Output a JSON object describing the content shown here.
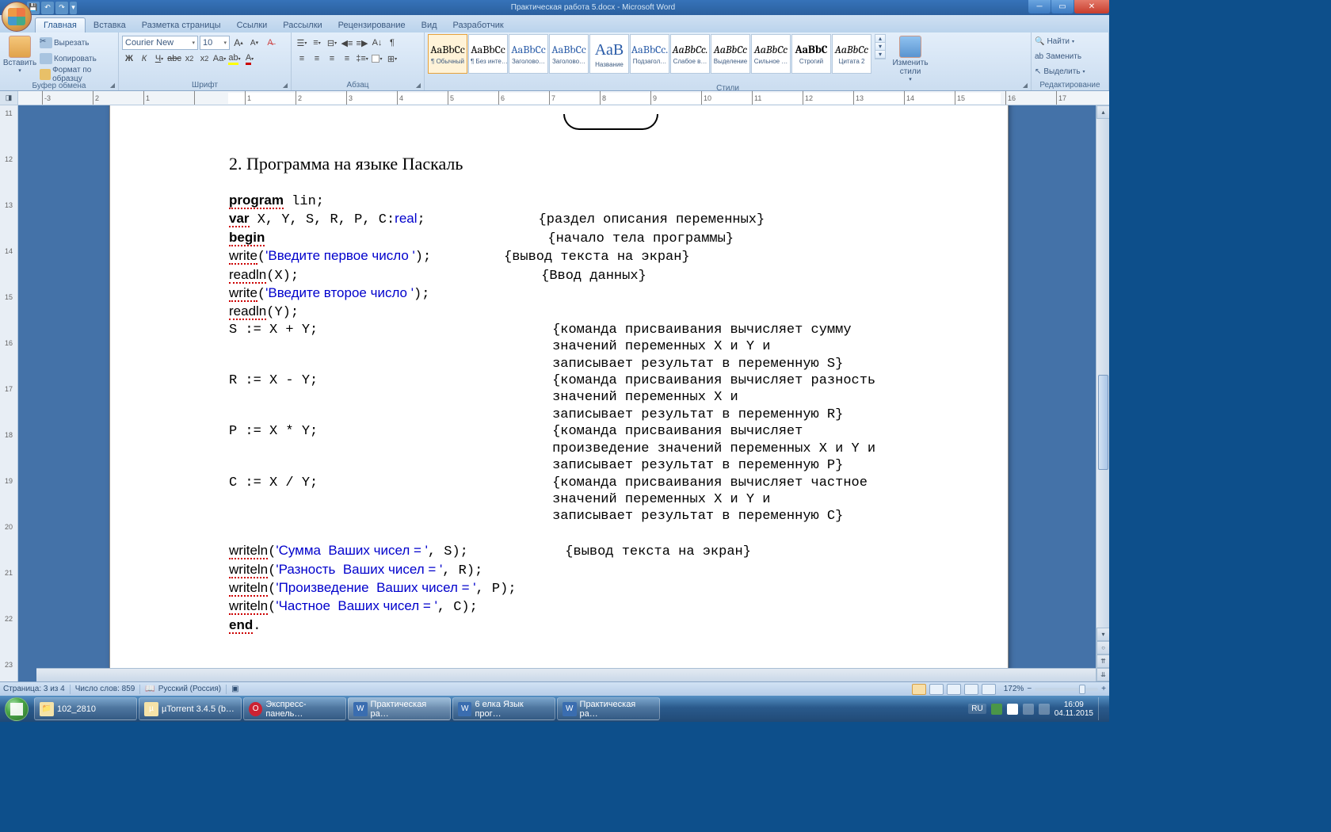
{
  "title_bar": {
    "document_title": "Практическая работа 5.docx - Microsoft Word"
  },
  "tabs": [
    "Главная",
    "Вставка",
    "Разметка страницы",
    "Ссылки",
    "Рассылки",
    "Рецензирование",
    "Вид",
    "Разработчик"
  ],
  "ribbon": {
    "clipboard": {
      "title": "Буфер обмена",
      "paste": "Вставить",
      "cut": "Вырезать",
      "copy": "Копировать",
      "painter": "Формат по образцу"
    },
    "font": {
      "title": "Шрифт",
      "family": "Courier New",
      "size": "10"
    },
    "paragraph": {
      "title": "Абзац"
    },
    "styles": {
      "title": "Стили",
      "items": [
        {
          "preview": "AaBbCc",
          "label": "¶ Обычный",
          "sel": true
        },
        {
          "preview": "AaBbCc",
          "label": "¶ Без инте…"
        },
        {
          "preview": "AaBbCc",
          "label": "Заголово…",
          "blue": true
        },
        {
          "preview": "AaBbCc",
          "label": "Заголово…",
          "blue": true
        },
        {
          "preview": "АаВ",
          "label": "Название",
          "blue": true,
          "big": true
        },
        {
          "preview": "AaBbCc.",
          "label": "Подзагол…",
          "blue": true
        },
        {
          "preview": "AaBbCc.",
          "label": "Слабое в…",
          "it": true
        },
        {
          "preview": "AaBbCc",
          "label": "Выделение",
          "it": true
        },
        {
          "preview": "AaBbCc",
          "label": "Сильное …",
          "it": true
        },
        {
          "preview": "AaBbC",
          "label": "Строгий",
          "bold": true
        },
        {
          "preview": "AaBbCc",
          "label": "Цитата 2",
          "it": true
        }
      ],
      "change": "Изменить стили"
    },
    "editing": {
      "title": "Редактирование",
      "find": "Найти",
      "replace": "Заменить",
      "select": "Выделить"
    }
  },
  "ruler_h": [
    "-3",
    "2",
    "1",
    "",
    "1",
    "2",
    "3",
    "4",
    "5",
    "6",
    "7",
    "8",
    "9",
    "10",
    "11",
    "12",
    "13",
    "14",
    "15",
    "16",
    "17"
  ],
  "ruler_v": [
    "11",
    "12",
    "13",
    "14",
    "15",
    "16",
    "17",
    "18",
    "19",
    "20",
    "21",
    "22",
    "23"
  ],
  "document": {
    "heading": "2. Программа на языке Паскаль",
    "code_lines": [
      {
        "t": "program lin;",
        "c": "",
        "pk": true
      },
      {
        "t": "var X, Y, S, R, P, C:real;",
        "c": "{раздел описания переменных}",
        "kw": "var",
        "ty": "real"
      },
      {
        "t": "begin",
        "c": "{начало тела программы}",
        "pk": true
      },
      {
        "t": "write('Введите первое число ');",
        "c": "{вывод текста на экран}",
        "fn": "write",
        "s": "'Введите первое число '"
      },
      {
        "t": "readln(X);",
        "c": "{Ввод данных}",
        "fn": "readln"
      },
      {
        "t": "write('Введите второе число ');",
        "c": "",
        "fn": "write",
        "s": "'Введите второе число '"
      },
      {
        "t": "readln(Y);",
        "c": "",
        "fn": "readln"
      },
      {
        "t": "S := X + Y;",
        "c": "{команда присваивания вычисляет сумму"
      },
      {
        "t": "",
        "c": "значений переменных X и Y и"
      },
      {
        "t": "",
        "c": "записывает результат в переменную S}"
      },
      {
        "t": "R := X - Y;",
        "c": "{команда присваивания вычисляет разность"
      },
      {
        "t": "",
        "c": "значений переменных X и"
      },
      {
        "t": "",
        "c": "записывает результат в переменную R}"
      },
      {
        "t": "P := X * Y;",
        "c": "{команда присваивания вычисляет"
      },
      {
        "t": "",
        "c": "произведение значений переменных X и Y и"
      },
      {
        "t": "",
        "c": "записывает результат в переменную P}"
      },
      {
        "t": "C := X / Y;",
        "c": "{команда присваивания вычисляет частное"
      },
      {
        "t": "",
        "c": "значений переменных X и Y и"
      },
      {
        "t": "",
        "c": "записывает результат в переменную C}"
      },
      {
        "t": "",
        "c": ""
      },
      {
        "t": "writeln('Сумма  Ваших чисел = ', S);",
        "c": "        {вывод текста на экран}",
        "fn": "writeln",
        "s": "'Сумма  Ваших чисел = '"
      },
      {
        "t": "writeln('Разность  Ваших чисел = ', R);",
        "c": "",
        "fn": "writeln",
        "s": "'Разность  Ваших чисел = '"
      },
      {
        "t": "writeln('Произведение  Ваших чисел = ', P);",
        "c": "",
        "fn": "writeln",
        "s": "'Произведение  Ваших чисел = '"
      },
      {
        "t": "writeln('Частное  Ваших чисел = ', C);",
        "c": "",
        "fn": "writeln",
        "s": "'Частное  Ваших чисел = '"
      },
      {
        "t": "end.",
        "c": "",
        "pk": true
      }
    ]
  },
  "status": {
    "page": "Страница: 3 из 4",
    "words": "Число слов: 859",
    "lang": "Русский (Россия)",
    "zoom": "172%"
  },
  "taskbar": {
    "items": [
      {
        "label": "102_2810",
        "ico": "📁"
      },
      {
        "label": "µTorrent 3.4.5  (b…",
        "ico": "µ"
      },
      {
        "label": "Экспресс-панель…",
        "ico": "O",
        "opera": true
      },
      {
        "label": "Практическая ра…",
        "ico": "W",
        "word": true,
        "active": true
      },
      {
        "label": "6 елка Язык прог…",
        "ico": "W",
        "word": true
      },
      {
        "label": "Практическая ра…",
        "ico": "W",
        "word": true
      }
    ],
    "lang": "RU",
    "time": "16:09",
    "date": "04.11.2015"
  }
}
